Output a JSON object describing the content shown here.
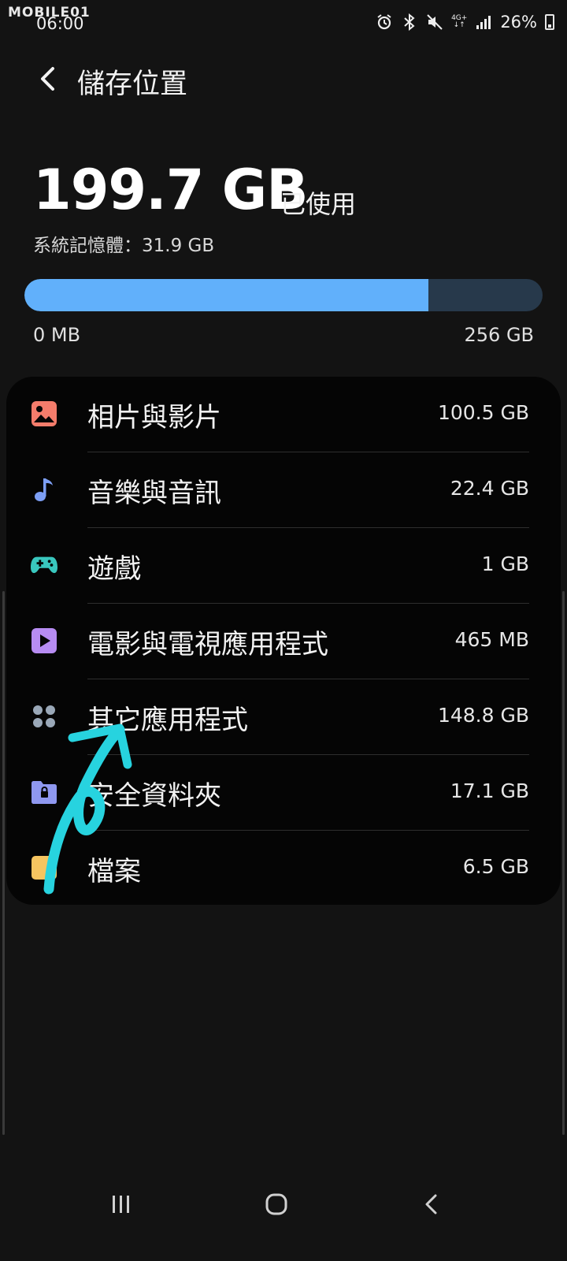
{
  "status_bar": {
    "watermark": "MOBILE01",
    "time": "06:00",
    "network": "4G+",
    "battery": "26%"
  },
  "header": {
    "title": "儲存位置"
  },
  "storage": {
    "used_amount": "199.7 GB",
    "used_label": "已使用",
    "system_memory": "系統記憶體：31.9 GB",
    "bar_min": "0 MB",
    "bar_max": "256 GB",
    "used_fraction": 0.78
  },
  "categories": [
    {
      "label": "相片與影片",
      "value": "100.5 GB",
      "icon": "image-icon",
      "color": "#f47c6b"
    },
    {
      "label": "音樂與音訊",
      "value": "22.4 GB",
      "icon": "music-note-icon",
      "color": "#7d9ff5"
    },
    {
      "label": "遊戲",
      "value": "1 GB",
      "icon": "gamepad-icon",
      "color": "#39c7be"
    },
    {
      "label": "電影與電視應用程式",
      "value": "465 MB",
      "icon": "play-icon",
      "color": "#b78cf2"
    },
    {
      "label": "其它應用程式",
      "value": "148.8 GB",
      "icon": "apps-grid-icon",
      "color": "#9aa8b8"
    },
    {
      "label": "安全資料夾",
      "value": "17.1 GB",
      "icon": "secure-folder-icon",
      "color": "#8f98f0"
    },
    {
      "label": "檔案",
      "value": "6.5 GB",
      "icon": "folder-icon",
      "color": "#f6c560"
    }
  ],
  "annotation_color": "#27d3df"
}
